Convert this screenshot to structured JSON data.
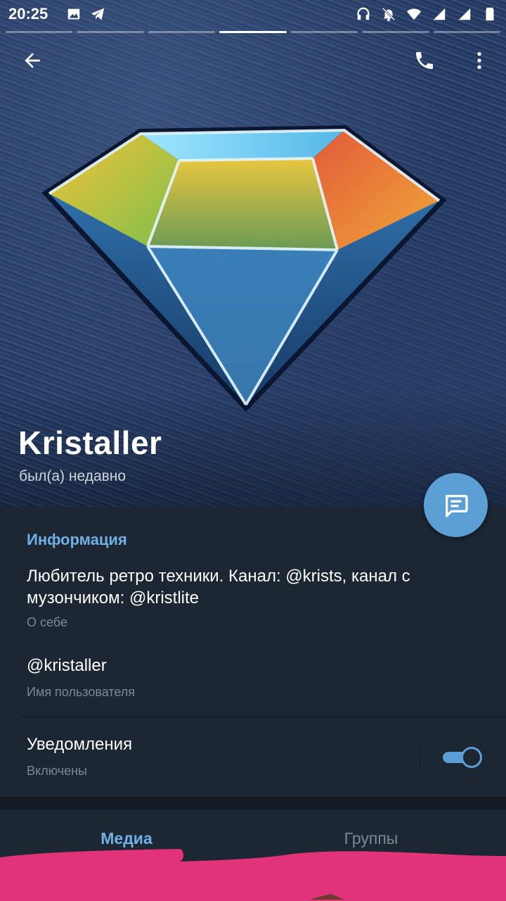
{
  "status_bar": {
    "time": "20:25",
    "left_icons": [
      "gallery-icon",
      "telegram-icon"
    ],
    "right_icons": [
      "headphones-icon",
      "bell-off-icon",
      "wifi-icon",
      "signal-icon",
      "signal-icon",
      "battery-icon"
    ]
  },
  "story_progress": {
    "segments": 7,
    "active_index": 3
  },
  "profile": {
    "name": "Kristaller",
    "status": "был(а) недавно"
  },
  "info": {
    "section_title": "Информация",
    "bio": "Любитель ретро техники. Канал: @krists, канал с музончиком: @kristlite",
    "bio_caption": "О себе",
    "username": "@kristaller",
    "username_caption": "Имя пользователя",
    "notifications_label": "Уведомления",
    "notifications_caption": "Включены",
    "notifications_enabled": true
  },
  "tabs": {
    "media": "Медиа",
    "groups": "Группы",
    "active": "media"
  },
  "colors": {
    "background": "#1d2733",
    "accent": "#5b9fd4",
    "accent_text": "#6fb0e6",
    "secondary_text": "#7b8896",
    "scribble": "#e0337a"
  }
}
